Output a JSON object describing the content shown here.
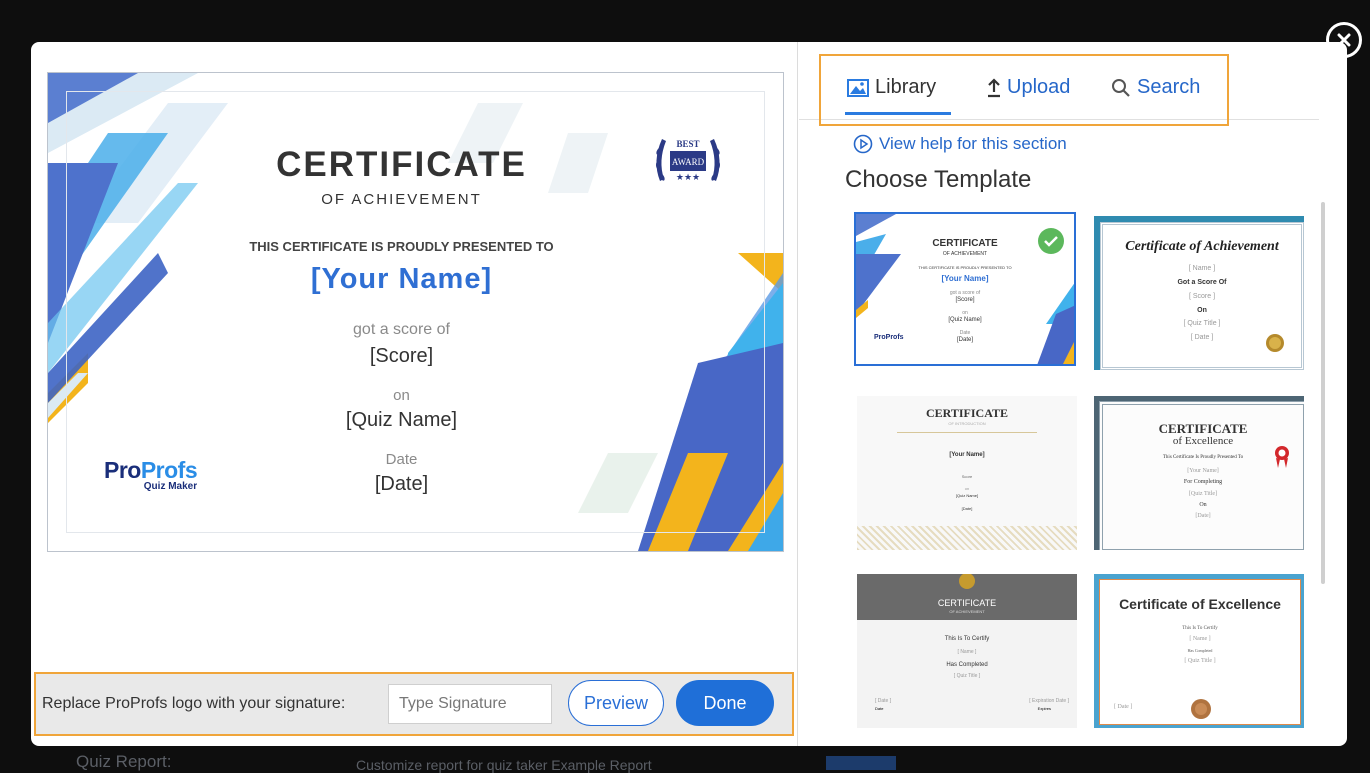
{
  "background": {
    "quiz_report_label": "Quiz Report:",
    "customize_text": "Customize report for quiz taker    Example Report"
  },
  "certificate": {
    "title": "CERTIFICATE",
    "subtitle": "OF ACHIEVEMENT",
    "presented": "THIS CERTIFICATE IS PROUDLY PRESENTED TO",
    "name": "[Your Name]",
    "got_score": "got a score of",
    "score": "[Score]",
    "on": "on",
    "quiz_name": "[Quiz Name]",
    "date_label": "Date",
    "date": "[Date]",
    "badge_top": "BEST",
    "badge_bottom": "AWARD",
    "logo_pro": "Pro",
    "logo_profs": "Profs",
    "logo_sub": "Quiz Maker"
  },
  "signature": {
    "label": "Replace ProProfs logo with your signature:",
    "placeholder": "Type Signature",
    "value": "",
    "preview_label": "Preview",
    "done_label": "Done"
  },
  "tabs": [
    {
      "label": "Library",
      "icon": "image-icon",
      "active": true
    },
    {
      "label": "Upload",
      "icon": "upload-icon",
      "active": false
    },
    {
      "label": "Search",
      "icon": "search-icon",
      "active": false
    }
  ],
  "help_link": "View help for this section",
  "choose_template": "Choose Template",
  "templates": {
    "t1": {
      "title": "CERTIFICATE",
      "subtitle": "OF ACHIEVEMENT",
      "presented": "THIS CERTIFICATE IS PROUDLY PRESENTED TO",
      "name": "[Your Name]",
      "got": "got a score of",
      "score": "[Score]",
      "on": "on",
      "quiz": "[Quiz Name]",
      "date_label": "Date",
      "date": "[Date]",
      "logo": "ProProfs",
      "selected": true
    },
    "t2": {
      "title": "Certificate of Achievement",
      "name": "[ Name ]",
      "got": "Got a Score Of",
      "score": "[ Score ]",
      "on": "On",
      "quiz": "[ Quiz Title ]",
      "date": "[ Date ]"
    },
    "t3": {
      "title": "CERTIFICATE",
      "subtitle": "OF INTRODUCTION",
      "name": "[Your Name]",
      "score": "Score",
      "on": "on",
      "quiz": "[Quiz Name]",
      "date": "[Date]"
    },
    "t4": {
      "title": "CERTIFICATE",
      "subtitle": "of Excellence",
      "presented": "This Certificate Is Proudly Presented To",
      "name": "[Your Name]",
      "for": "For Completing",
      "quiz": "[Quiz Title]",
      "on": "On",
      "date": "[Date]"
    },
    "t5": {
      "title": "CERTIFICATE",
      "subtitle": "OF ACHIEVEMENT",
      "certify": "This Is To Certify",
      "name": "[ Name ]",
      "completed": "Has Completed",
      "quiz": "[ Quiz Title ]",
      "date": "[ Date ]",
      "date_label": "Date",
      "expiration": "[ Expiration Date ]",
      "expires_label": "Expires"
    },
    "t6": {
      "title": "Certificate of Excellence",
      "certify": "This Is To Certify",
      "name": "[ Name ]",
      "completed": "Has Completed",
      "quiz": "[ Quiz Title ]",
      "date": "[ Date ]"
    }
  }
}
